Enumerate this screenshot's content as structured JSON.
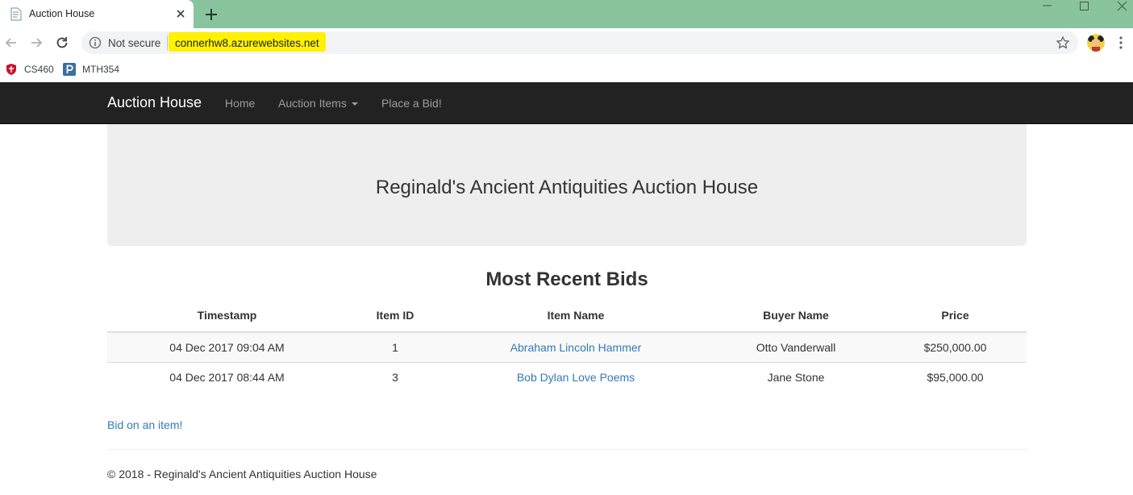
{
  "browser": {
    "tab_title": "Auction House",
    "security_label": "Not secure",
    "url": "connerhw8.azurewebsites.net",
    "url_highlight_color": "#fff200",
    "tab_strip_color": "#8ac49e",
    "bookmarks": [
      {
        "label": "CS460",
        "icon": "shield-icon"
      },
      {
        "label": "MTH354",
        "icon": "pearson-icon"
      }
    ]
  },
  "navbar": {
    "brand": "Auction House",
    "links": [
      {
        "label": "Home"
      },
      {
        "label": "Auction Items",
        "dropdown": true
      },
      {
        "label": "Place a Bid!"
      }
    ]
  },
  "jumbotron": {
    "title": "Reginald's Ancient Antiquities Auction House"
  },
  "bids": {
    "title": "Most Recent Bids",
    "columns": [
      "Timestamp",
      "Item ID",
      "Item Name",
      "Buyer Name",
      "Price"
    ],
    "rows": [
      {
        "timestamp": "04 Dec 2017 09:04 AM",
        "item_id": "1",
        "item_name": "Abraham Lincoln Hammer",
        "buyer": "Otto Vanderwall",
        "price": "$250,000.00"
      },
      {
        "timestamp": "04 Dec 2017 08:44 AM",
        "item_id": "3",
        "item_name": "Bob Dylan Love Poems",
        "buyer": "Jane Stone",
        "price": "$95,000.00"
      }
    ],
    "link_color": "#337ab7"
  },
  "bid_link": "Bid on an item!",
  "footer": "© 2018 - Reginald's Ancient Antiquities Auction House"
}
